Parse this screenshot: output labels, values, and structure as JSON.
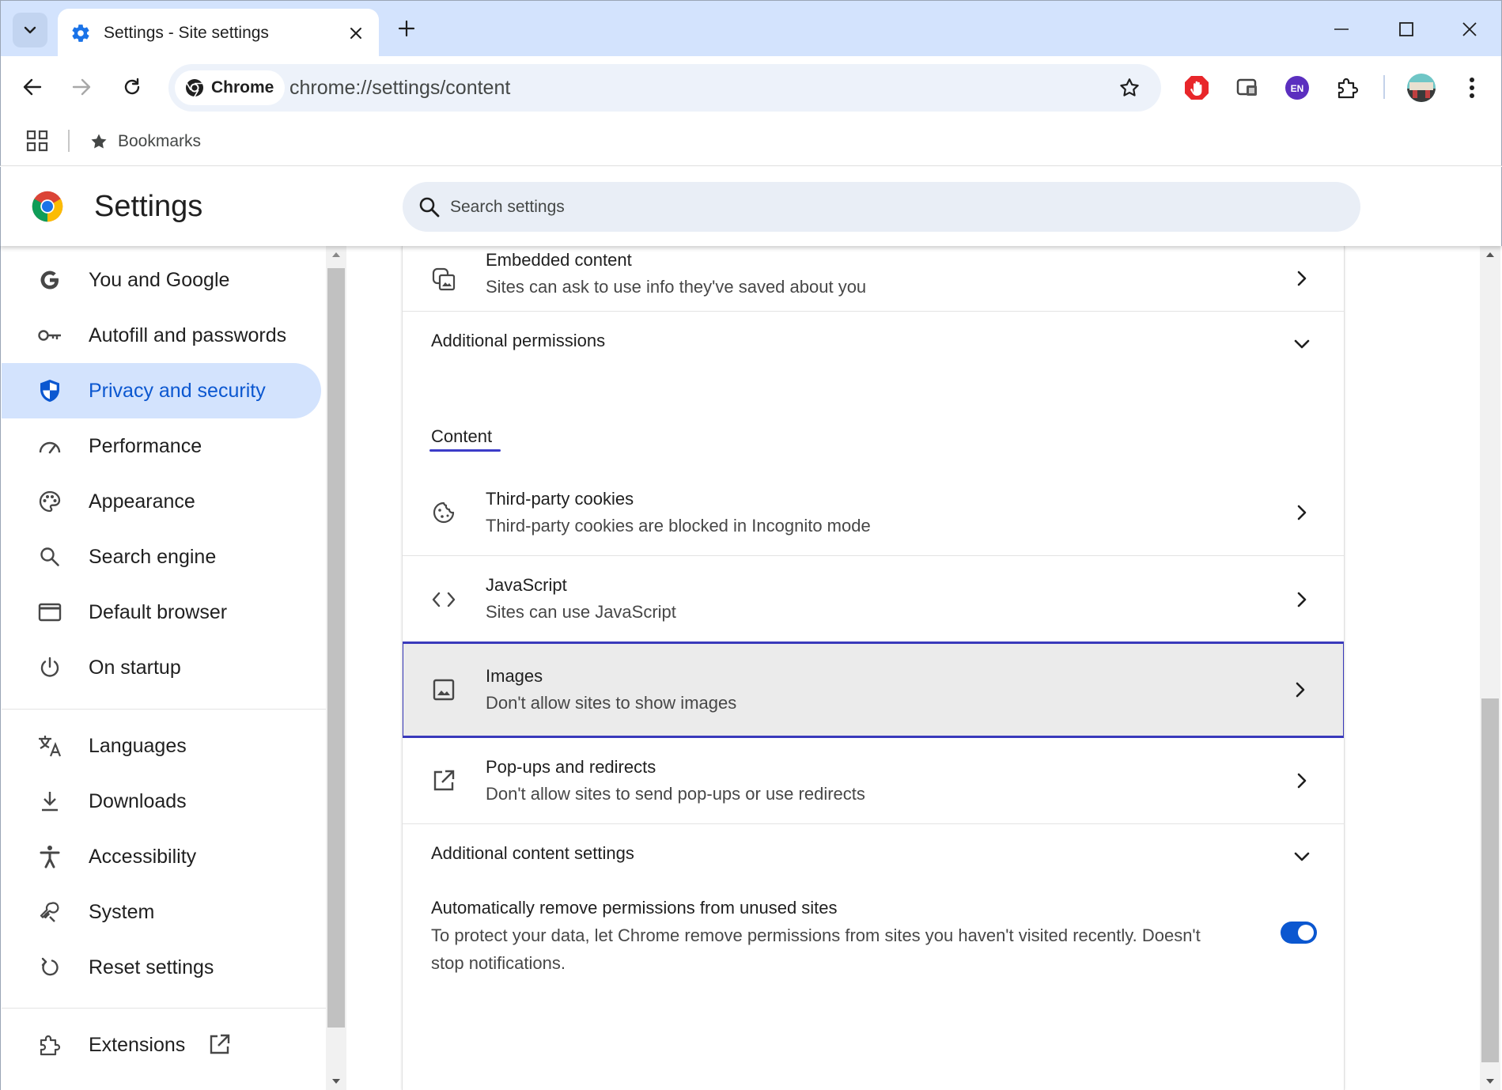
{
  "browser": {
    "tab_title": "Settings - Site settings",
    "omnibox_chip": "Chrome",
    "url": "chrome://settings/content",
    "bookmarks_label": "Bookmarks",
    "extension_badge": "EN"
  },
  "settings": {
    "title": "Settings",
    "search_placeholder": "Search settings"
  },
  "nav": {
    "items": [
      {
        "label": "You and Google",
        "icon": "google-icon"
      },
      {
        "label": "Autofill and passwords",
        "icon": "key-icon"
      },
      {
        "label": "Privacy and security",
        "icon": "shield-icon",
        "active": true
      },
      {
        "label": "Performance",
        "icon": "speedometer-icon"
      },
      {
        "label": "Appearance",
        "icon": "palette-icon"
      },
      {
        "label": "Search engine",
        "icon": "search-icon"
      },
      {
        "label": "Default browser",
        "icon": "browser-window-icon"
      },
      {
        "label": "On startup",
        "icon": "power-icon"
      },
      {
        "label": "Languages",
        "icon": "translate-icon"
      },
      {
        "label": "Downloads",
        "icon": "download-icon"
      },
      {
        "label": "Accessibility",
        "icon": "accessibility-icon"
      },
      {
        "label": "System",
        "icon": "wrench-icon"
      },
      {
        "label": "Reset settings",
        "icon": "reset-icon"
      },
      {
        "label": "Extensions",
        "icon": "puzzle-icon"
      }
    ]
  },
  "content": {
    "embedded": {
      "title": "Embedded content",
      "subtitle": "Sites can ask to use info they've saved about you"
    },
    "additional_permissions": "Additional permissions",
    "section_label": "Content",
    "cookies": {
      "title": "Third-party cookies",
      "subtitle": "Third-party cookies are blocked in Incognito mode"
    },
    "javascript": {
      "title": "JavaScript",
      "subtitle": "Sites can use JavaScript"
    },
    "images": {
      "title": "Images",
      "subtitle": "Don't allow sites to show images"
    },
    "popups": {
      "title": "Pop-ups and redirects",
      "subtitle": "Don't allow sites to send pop-ups or use redirects"
    },
    "additional_content": "Additional content settings",
    "auto_remove": {
      "title": "Automatically remove permissions from unused sites",
      "description": "To protect your data, let Chrome remove permissions from sites you haven't visited recently. Doesn't stop notifications.",
      "enabled": true
    }
  },
  "colors": {
    "accent": "#0b57d0",
    "active_nav_bg": "#d3e3fd",
    "highlight_border": "#3939bb"
  }
}
